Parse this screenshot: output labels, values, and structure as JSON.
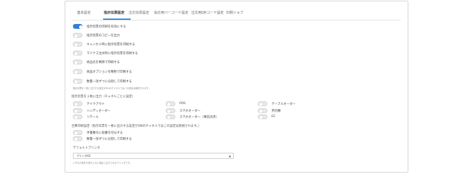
{
  "tabs": [
    "基本設定",
    "指示伝票設定",
    "注文伝票設定",
    "会計用バーコード設定",
    "注文用QRコード設定",
    "印刷ジョブ"
  ],
  "toggles": [
    {
      "label": "指示伝票の印刷を有効にする",
      "on": true
    },
    {
      "label": "指示伝票のコピーを出力",
      "on": false
    },
    {
      "label": "キャンセル時に指示伝票を印刷する",
      "on": false
    },
    {
      "label": "マイナス注文時に指示伝票を印刷する",
      "on": false
    },
    {
      "label": "商品名を略称で印刷する",
      "on": false
    },
    {
      "label": "商品オプションを略称で印刷する",
      "on": false
    },
    {
      "label": "数量一括ずつに分割して印刷する",
      "on": false
    }
  ],
  "split_note": "指示伝票を一枚に出力する設定がONのチャネルではこの設定は無視されます。",
  "channel_section": {
    "title": "指示伝票を１枚に出力（チャネルごとに設定）",
    "col1": [
      "テイクアウト",
      "ハンディオーダー",
      "リテール"
    ],
    "col2": [
      "POS",
      "スマホオーダー",
      "スマホオーダー（事前決済）"
    ],
    "col3": [
      "テーブルオーダー",
      "券売機",
      "EC"
    ]
  },
  "combined_section": {
    "title": "合算印刷設定（指示伝票を一枚に出力する設定がONのチャネルではこの設定は無視されます。）",
    "items": [
      "手書番号に就番を付与する",
      "数量一括ずつに分割して印刷する"
    ]
  },
  "printer": {
    "label": "デフォルトプリンタ",
    "value": "プリンタ01",
    "note": "いずれの条件も満たさない場合に出力されるプリンタです。"
  }
}
